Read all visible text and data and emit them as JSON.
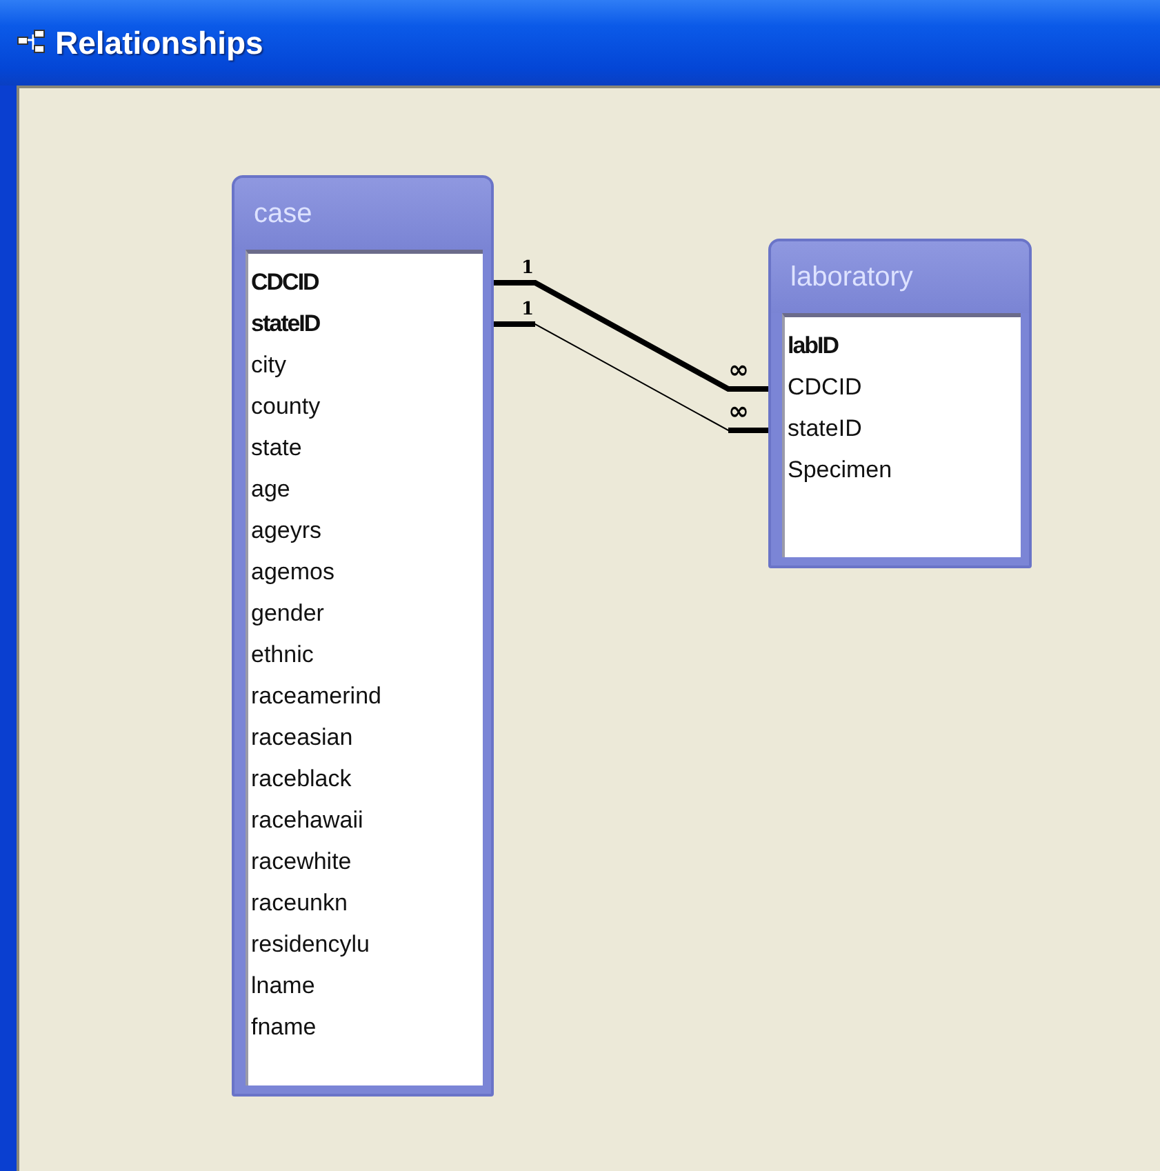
{
  "window": {
    "title": "Relationships"
  },
  "tables": [
    {
      "name": "case",
      "fields": [
        {
          "name": "CDCID",
          "key": true
        },
        {
          "name": "stateID",
          "key": true
        },
        {
          "name": "city",
          "key": false
        },
        {
          "name": "county",
          "key": false
        },
        {
          "name": "state",
          "key": false
        },
        {
          "name": "age",
          "key": false
        },
        {
          "name": "ageyrs",
          "key": false
        },
        {
          "name": "agemos",
          "key": false
        },
        {
          "name": "gender",
          "key": false
        },
        {
          "name": "ethnic",
          "key": false
        },
        {
          "name": "raceamerind",
          "key": false
        },
        {
          "name": "raceasian",
          "key": false
        },
        {
          "name": "raceblack",
          "key": false
        },
        {
          "name": "racehawaii",
          "key": false
        },
        {
          "name": "racewhite",
          "key": false
        },
        {
          "name": "raceunkn",
          "key": false
        },
        {
          "name": "residencylu",
          "key": false
        },
        {
          "name": "lname",
          "key": false
        },
        {
          "name": "fname",
          "key": false
        }
      ]
    },
    {
      "name": "laboratory",
      "fields": [
        {
          "name": "labID",
          "key": true
        },
        {
          "name": "CDCID",
          "key": false
        },
        {
          "name": "stateID",
          "key": false
        },
        {
          "name": "Specimen",
          "key": false
        }
      ]
    }
  ],
  "relationships": [
    {
      "from_label": "1",
      "to_label": "∞",
      "enforced": true
    },
    {
      "from_label": "1",
      "to_label": "∞",
      "enforced": false
    }
  ]
}
